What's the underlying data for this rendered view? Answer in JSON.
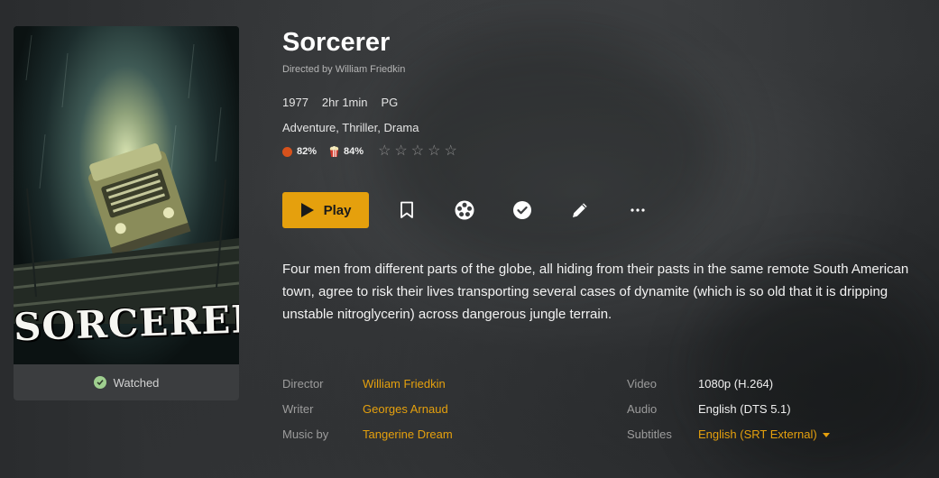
{
  "movie": {
    "title": "Sorcerer",
    "directed_by": "Directed by William Friedkin",
    "year": "1977",
    "runtime": "2hr 1min",
    "rating": "PG",
    "genres": "Adventure, Thriller, Drama",
    "critic_score": "82%",
    "audience_score": "84%",
    "user_stars": 0,
    "summary": "Four men from different parts of the globe, all hiding from their pasts in the same remote South American town, agree to risk their lives transporting several cases of dynamite (which is so old that it is dripping unstable nitroglycerin) across dangerous jungle terrain."
  },
  "poster": {
    "title_text": "SORCERER",
    "watched_label": "Watched"
  },
  "actions": {
    "play_label": "Play",
    "icons": [
      "bookmark-icon",
      "trailer-reel-icon",
      "mark-watched-icon",
      "edit-pencil-icon",
      "more-options-icon"
    ]
  },
  "credits": [
    {
      "label": "Director",
      "value": "William Friedkin"
    },
    {
      "label": "Writer",
      "value": "Georges Arnaud"
    },
    {
      "label": "Music by",
      "value": "Tangerine Dream"
    }
  ],
  "media": [
    {
      "label": "Video",
      "value": "1080p (H.264)"
    },
    {
      "label": "Audio",
      "value": "English (DTS 5.1)"
    },
    {
      "label": "Subtitles",
      "value": "English (SRT External)"
    }
  ],
  "colors": {
    "accent": "#e5a00d",
    "background": "#333537",
    "watched_check": "#9fcf8f",
    "tomato": "#d7521c"
  }
}
